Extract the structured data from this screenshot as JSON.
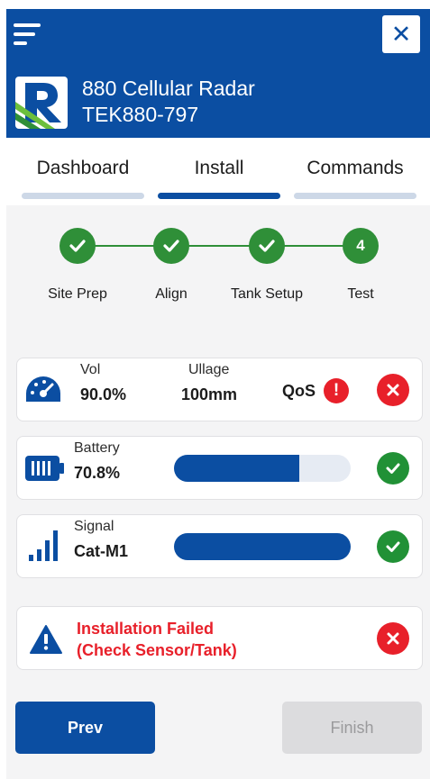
{
  "header": {
    "device_name": "880 Cellular Radar",
    "device_id": "TEK880-797",
    "close_icon": "close-icon",
    "menu_icon": "hamburger-menu-icon",
    "brand_color": "#0b4ea2"
  },
  "tabs": [
    {
      "label": "Dashboard",
      "active": false
    },
    {
      "label": "Install",
      "active": true
    },
    {
      "label": "Commands",
      "active": false
    }
  ],
  "steps": [
    {
      "label": "Site Prep",
      "state": "done"
    },
    {
      "label": "Align",
      "state": "done"
    },
    {
      "label": "Tank Setup",
      "state": "done"
    },
    {
      "label": "Test",
      "number": "4",
      "state": "current"
    }
  ],
  "level_card": {
    "vol_label": "Vol",
    "vol_value": "90.0%",
    "ullage_label": "Ullage",
    "ullage_value": "100mm",
    "qos_label": "QoS",
    "qos_icon_text": "!",
    "status": "fail"
  },
  "battery_card": {
    "label": "Battery",
    "value": "70.8%",
    "level_fraction": 0.708,
    "status": "ok"
  },
  "signal_card": {
    "label": "Signal",
    "value": "Cat-M1",
    "level_fraction": 1.0,
    "status": "ok"
  },
  "alert": {
    "line1": "Installation Failed",
    "line2": "(Check Sensor/Tank)",
    "status": "fail",
    "color": "#e8202a"
  },
  "footer": {
    "prev_label": "Prev",
    "finish_label": "Finish",
    "finish_enabled": false
  }
}
